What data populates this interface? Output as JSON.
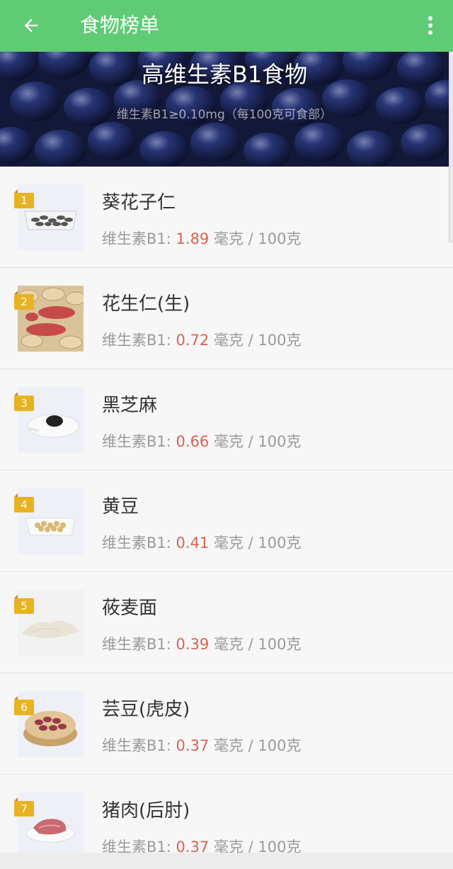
{
  "appbar": {
    "title": "食物榜单",
    "back_icon": "arrow-left-icon",
    "more_icon": "more-vert-icon",
    "color": "#5fcb74"
  },
  "banner": {
    "title": "高维生素B1食物",
    "subtitle": "维生素B1≥0.10mg（每100克可食部）"
  },
  "items": [
    {
      "rank": "1",
      "name": "葵花子仁",
      "label": "维生素B1:",
      "value": "1.89",
      "unit": "毫克 / 100克"
    },
    {
      "rank": "2",
      "name": "花生仁(生)",
      "label": "维生素B1:",
      "value": "0.72",
      "unit": "毫克 / 100克"
    },
    {
      "rank": "3",
      "name": "黑芝麻",
      "label": "维生素B1:",
      "value": "0.66",
      "unit": "毫克 / 100克"
    },
    {
      "rank": "4",
      "name": "黄豆",
      "label": "维生素B1:",
      "value": "0.41",
      "unit": "毫克 / 100克"
    },
    {
      "rank": "5",
      "name": "莜麦面",
      "label": "维生素B1:",
      "value": "0.39",
      "unit": "毫克 / 100克"
    },
    {
      "rank": "6",
      "name": "芸豆(虎皮)",
      "label": "维生素B1:",
      "value": "0.37",
      "unit": "毫克 / 100克"
    },
    {
      "rank": "7",
      "name": "猪肉(后肘)",
      "label": "维生素B1:",
      "value": "0.37",
      "unit": "毫克 / 100克"
    }
  ],
  "colors": {
    "value": "#d9634f",
    "rank_badge": "#e8b320"
  }
}
